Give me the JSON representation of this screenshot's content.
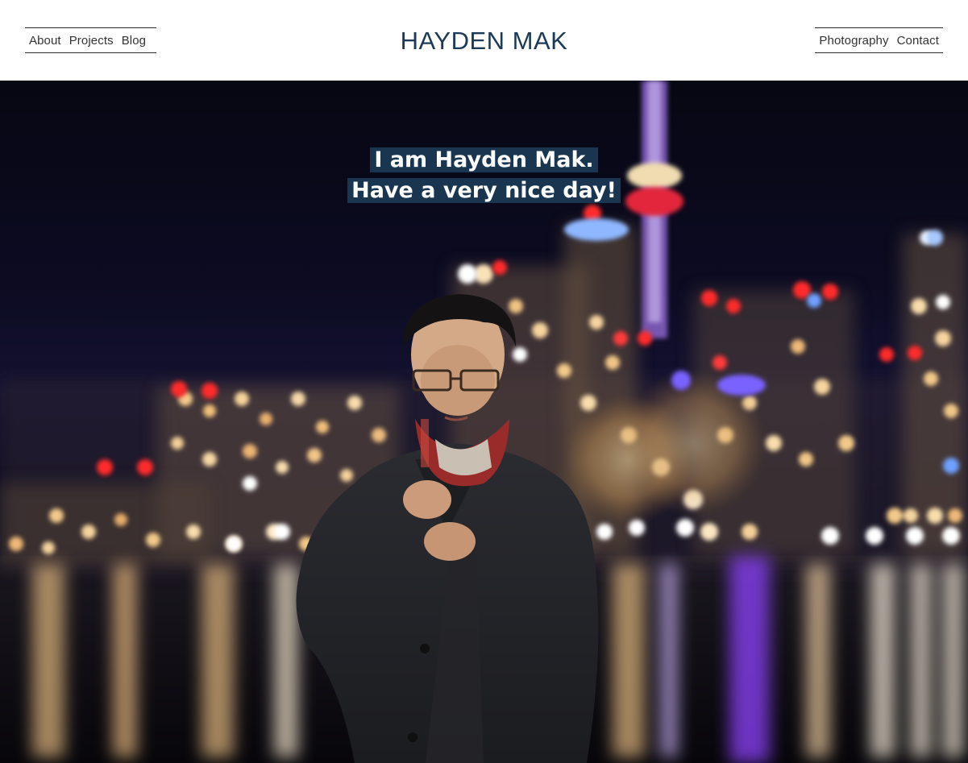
{
  "site": {
    "title": "HAYDEN MAK"
  },
  "nav": {
    "left": [
      {
        "label": "About"
      },
      {
        "label": "Projects"
      },
      {
        "label": "Blog"
      }
    ],
    "right": [
      {
        "label": "Photography"
      },
      {
        "label": "Contact"
      }
    ]
  },
  "hero": {
    "line1": "I am Hayden Mak.",
    "line2": "Have a very nice day!"
  },
  "colors": {
    "title": "#1c3a57",
    "tagline_bg": "#1a3550",
    "nav_text": "#333333"
  }
}
